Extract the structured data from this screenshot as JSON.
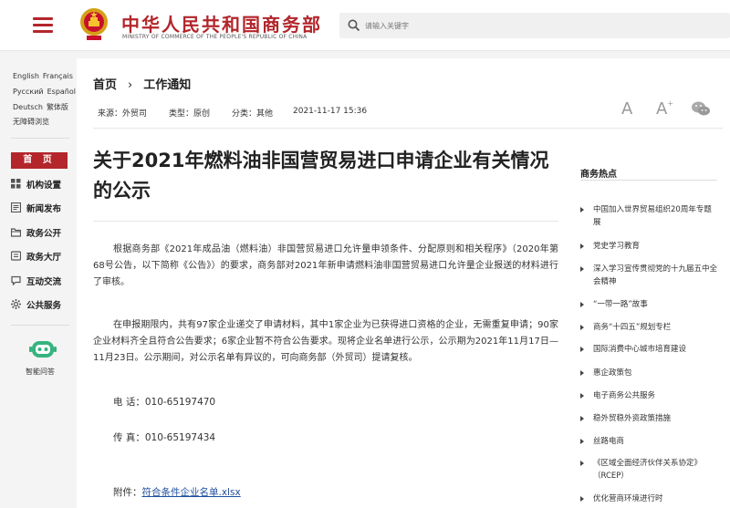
{
  "header": {
    "site_title": "中华人民共和国商务部",
    "site_subtitle": "MINISTRY OF COMMERCE OF THE PEOPLE'S REPUBLIC OF CHINA",
    "search_placeholder": "请输入关键字",
    "brand_color": "#b3262b"
  },
  "languages": {
    "row1": [
      "English",
      "Français"
    ],
    "row2": [
      "Русский",
      "Español"
    ],
    "row3": [
      "Deutsch",
      "繁体版"
    ],
    "row4": [
      "无障碍浏览"
    ]
  },
  "nav": {
    "home": "首 页",
    "items": [
      {
        "label": "机构设置",
        "icon": "org-grid-icon"
      },
      {
        "label": "新闻发布",
        "icon": "newspaper-icon"
      },
      {
        "label": "政务公开",
        "icon": "folder-icon"
      },
      {
        "label": "政务大厅",
        "icon": "hall-icon"
      },
      {
        "label": "互动交流",
        "icon": "chat-icon"
      },
      {
        "label": "公共服务",
        "icon": "gear-icon"
      }
    ],
    "assistant_label": "智能问答"
  },
  "breadcrumb": {
    "home": "首页",
    "separator": "›",
    "current": "工作通知"
  },
  "meta": {
    "source": "来源：外贸司",
    "type": "类型：原创",
    "category": "分类：其他",
    "datetime": "2021-11-17 15:36"
  },
  "tools": {
    "font_small": "A",
    "font_large": "A",
    "font_large_sup": "+"
  },
  "article": {
    "title": "关于2021年燃料油非国营贸易进口申请企业有关情况的公示",
    "para1": "根据商务部《2021年成品油（燃料油）非国营贸易进口允许量申领条件、分配原则和相关程序》（2020年第68号公告，以下简称《公告》）的要求，商务部对2021年新申请燃料油非国营贸易进口允许量企业报送的材料进行了审核。",
    "para2": "在申报期限内，共有97家企业递交了申请材料，其中1家企业为已获得进口资格的企业，无需重复申请；90家企业材料齐全且符合公告要求；6家企业暂不符合公告要求。现将企业名单进行公示，公示期为2021年11月17日— 11月23日。公示期间，对公示名单有异议的，可向商务部（外贸司）提请复核。",
    "phone": "电  话：010-65197470",
    "fax": "传  真：010-65197434",
    "attachment_label": "附件：",
    "attachment_link": "符合条件企业名单.xlsx"
  },
  "hot": {
    "title": "商务热点",
    "items": [
      "中国加入世界贸易组织20周年专题展",
      "党史学习教育",
      "深入学习宣传贯彻党的十九届五中全会精神",
      "“一带一路”故事",
      "商务“十四五”规划专栏",
      "国际消费中心城市培育建设",
      "惠企政策包",
      "电子商务公共服务",
      "稳外贸稳外资政策措施",
      "丝路电商",
      "《区域全面经济伙伴关系协定》（RCEP）",
      "优化营商环境进行时"
    ]
  }
}
